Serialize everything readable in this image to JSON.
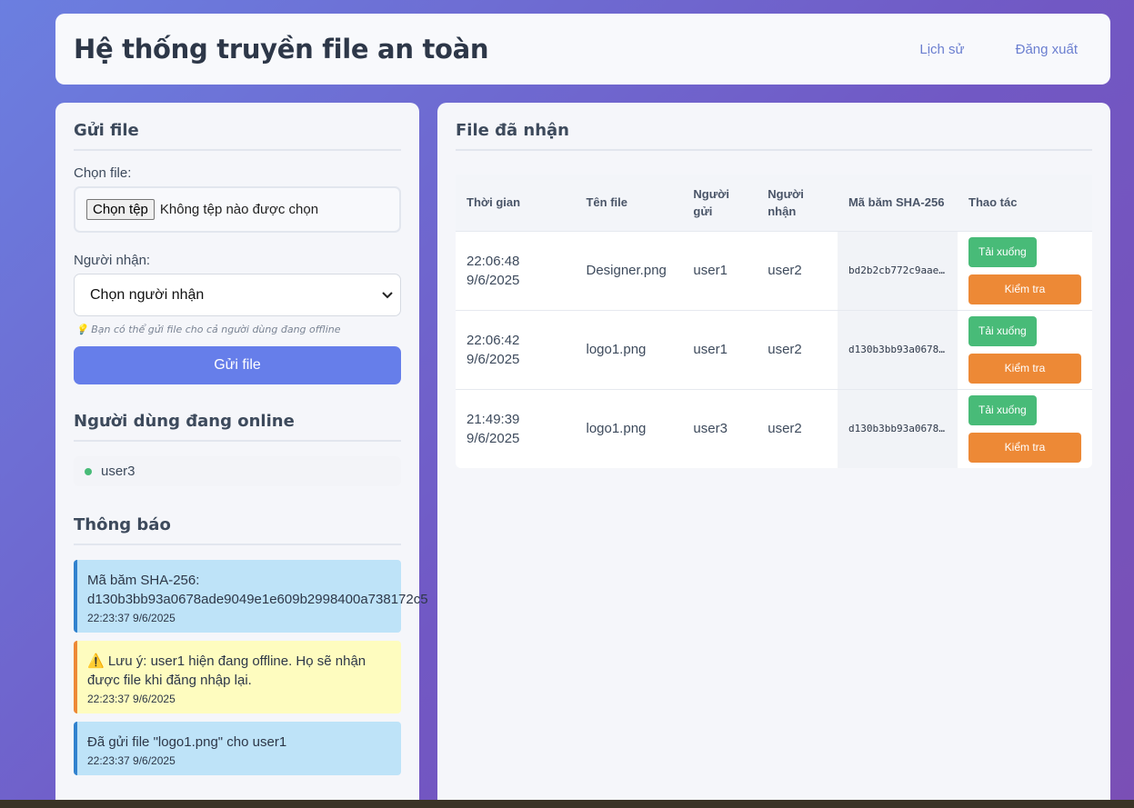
{
  "header": {
    "title": "Hệ thống truyền file an toàn",
    "nav_history": "Lịch sử",
    "nav_logout": "Đăng xuất"
  },
  "send": {
    "title": "Gửi file",
    "file_label": "Chọn file:",
    "file_button": "Chọn tệp",
    "file_status": "Không tệp nào được chọn",
    "recipient_label": "Người nhận:",
    "recipient_selected": "Chọn người nhận",
    "hint": "💡 Bạn có thể gửi file cho cả người dùng đang offline",
    "submit": "Gửi file"
  },
  "online": {
    "title": "Người dùng đang online",
    "users": [
      "user3"
    ]
  },
  "notifications": {
    "title": "Thông báo",
    "items": [
      {
        "text": "Mã băm SHA-256:",
        "hash": "d130b3bb93a0678ade9049e1e609b2998400a738172c5",
        "time": "22:23:37 9/6/2025"
      },
      {
        "text": "⚠️ Lưu ý: user1 hiện đang offline. Họ sẽ nhận được file khi đăng nhập lại.",
        "time": "22:23:37 9/6/2025"
      },
      {
        "text": "Đã gửi file \"logo1.png\" cho user1",
        "time": "22:23:37 9/6/2025"
      }
    ]
  },
  "received": {
    "title": "File đã nhận",
    "columns": [
      "Thời gian",
      "Tên file",
      "Người gửi",
      "Người nhận",
      "Mã băm SHA-256",
      "Thao tác"
    ],
    "download_label": "Tải xuống",
    "verify_label": "Kiểm tra",
    "rows": [
      {
        "time": "22:06:48 9/6/2025",
        "file": "Designer.png",
        "sender": "user1",
        "receiver": "user2",
        "hash": "bd2b2cb772c9aae..."
      },
      {
        "time": "22:06:42 9/6/2025",
        "file": "logo1.png",
        "sender": "user1",
        "receiver": "user2",
        "hash": "d130b3bb93a0678..."
      },
      {
        "time": "21:49:39 9/6/2025",
        "file": "logo1.png",
        "sender": "user3",
        "receiver": "user2",
        "hash": "d130b3bb93a0678..."
      }
    ]
  }
}
